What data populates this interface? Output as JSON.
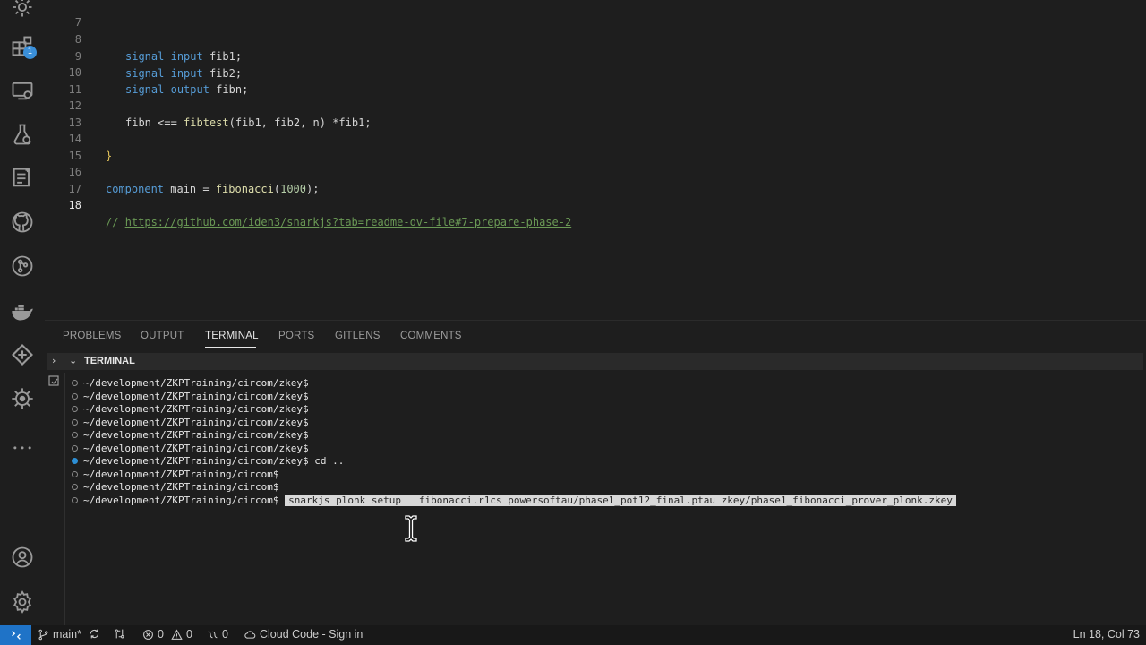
{
  "editor": {
    "lines": [
      {
        "num": "7",
        "code": ""
      },
      {
        "num": "8",
        "code": "signal input fib1;"
      },
      {
        "num": "9",
        "code": "signal input fib2;"
      },
      {
        "num": "10",
        "code": "signal output fibn;"
      },
      {
        "num": "11",
        "code": ""
      },
      {
        "num": "12",
        "code": "fibn <== fibtest(fib1, fib2, n) *fib1;"
      },
      {
        "num": "13",
        "code": ""
      },
      {
        "num": "14",
        "code": "}"
      },
      {
        "num": "15",
        "code": ""
      },
      {
        "num": "16",
        "code": "component main = fibonacci(1000);"
      },
      {
        "num": "17",
        "code": ""
      },
      {
        "num": "18",
        "code": "// https://github.com/iden3/snarkjs?tab=readme-ov-file#7-prepare-phase-2"
      }
    ],
    "tokens": {
      "signal": "signal",
      "input": "input",
      "output": "output",
      "fib1_decl": "fib1;",
      "fib2_decl": "fib2;",
      "fibn_decl": "fibn;",
      "l12_a": "fibn <== ",
      "l12_fn": "fibtest",
      "l12_b": "(fib1, fib2, n) *fib1;",
      "l14": "}",
      "component": "component",
      "l16_a": " main = ",
      "l16_fn": "fibonacci",
      "l16_paren_open": "(",
      "l16_num": "1000",
      "l16_end": ");",
      "comment_prefix": "// ",
      "link": "https://github.com/iden3/snarkjs?tab=readme-ov-file#7-prepare-phase-2"
    }
  },
  "panel": {
    "tabs": [
      "PROBLEMS",
      "OUTPUT",
      "TERMINAL",
      "PORTS",
      "GITLENS",
      "COMMENTS"
    ],
    "active_tab": "TERMINAL",
    "terminal_title": "TERMINAL",
    "terminal_lines": [
      {
        "prompt": "~/development/ZKPTraining/circom/zkey$",
        "cmd": ""
      },
      {
        "prompt": "~/development/ZKPTraining/circom/zkey$",
        "cmd": ""
      },
      {
        "prompt": "~/development/ZKPTraining/circom/zkey$",
        "cmd": ""
      },
      {
        "prompt": "~/development/ZKPTraining/circom/zkey$",
        "cmd": ""
      },
      {
        "prompt": "~/development/ZKPTraining/circom/zkey$",
        "cmd": ""
      },
      {
        "prompt": "~/development/ZKPTraining/circom/zkey$",
        "cmd": ""
      },
      {
        "prompt": "~/development/ZKPTraining/circom/zkey$",
        "cmd": " cd .."
      },
      {
        "prompt": "~/development/ZKPTraining/circom$",
        "cmd": ""
      },
      {
        "prompt": "~/development/ZKPTraining/circom$",
        "cmd": ""
      },
      {
        "prompt": "~/development/ZKPTraining/circom$",
        "cmd": ""
      }
    ],
    "selected_command": "snarkjs plonk setup   fibonacci.r1cs powersoftau/phase1_pot12_final.ptau zkey/phase1_fibonacci_prover_plonk.zkey"
  },
  "activity_bar": {
    "icons": [
      "settings-gear-icon",
      "extensions-icon",
      "remote-explorer-icon",
      "testing-icon",
      "notes-icon",
      "github-icon",
      "git-graph-icon",
      "docker-icon",
      "kubernetes-icon",
      "helm-icon",
      "more-icon",
      "account-icon",
      "manage-gear-icon"
    ],
    "extensions_badge": "1"
  },
  "status_bar": {
    "branch": "main*",
    "errors": "0",
    "warnings": "0",
    "ports": "0",
    "cloud_code": "Cloud Code - Sign in",
    "cursor_position": "Ln 18, Col 73",
    "remote_color": "#1f73c7"
  }
}
